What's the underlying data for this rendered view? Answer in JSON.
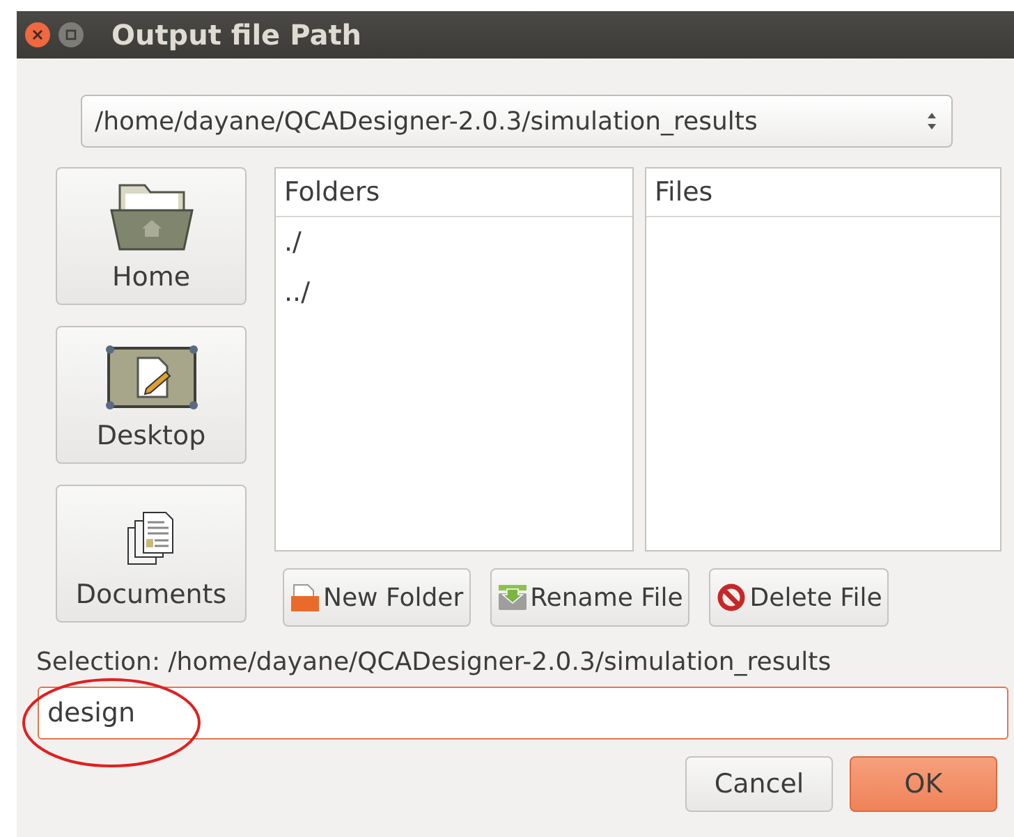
{
  "window": {
    "title": "Output file Path"
  },
  "path_combo": {
    "value": "/home/dayane/QCADesigner-2.0.3/simulation_results"
  },
  "places": [
    {
      "label": "Home",
      "kind": "home"
    },
    {
      "label": "Desktop",
      "kind": "desktop"
    },
    {
      "label": "Documents",
      "kind": "documents"
    }
  ],
  "folders": {
    "heading": "Folders",
    "items": [
      {
        "label": "./"
      },
      {
        "label": "../"
      }
    ]
  },
  "files": {
    "heading": "Files"
  },
  "actions": [
    {
      "label": "New Folder",
      "kind": "new-folder"
    },
    {
      "label": "Rename File",
      "kind": "rename"
    },
    {
      "label": "Delete File",
      "kind": "delete"
    }
  ],
  "selection": {
    "text": "Selection: /home/dayane/QCADesigner-2.0.3/simulation_results"
  },
  "filename": {
    "value": "design",
    "focused": true
  },
  "buttons": [
    {
      "label": "Cancel",
      "kind": "secondary"
    },
    {
      "label": "OK",
      "kind": "primary"
    }
  ]
}
